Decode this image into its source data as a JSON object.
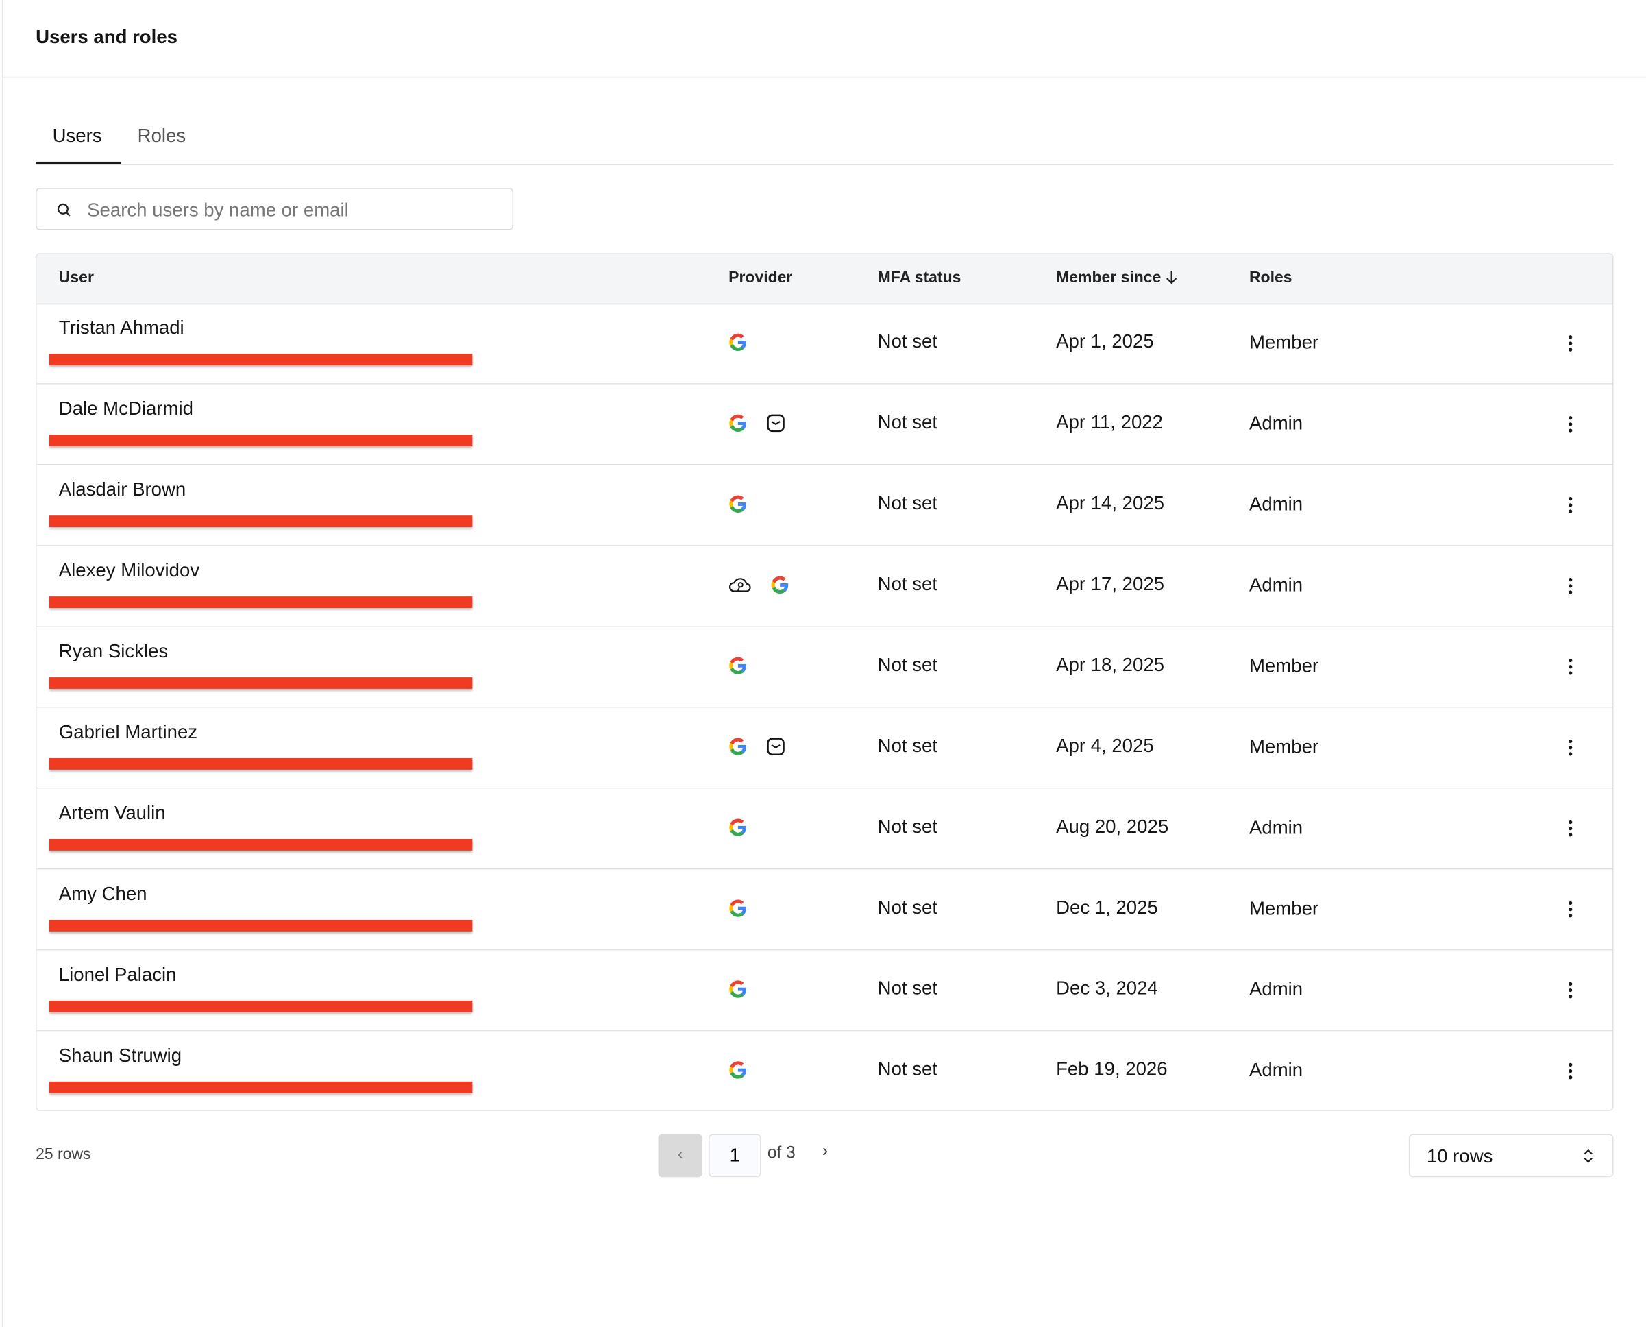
{
  "header": {
    "title": "Users and roles"
  },
  "tabs": [
    {
      "label": "Users",
      "active": true
    },
    {
      "label": "Roles",
      "active": false
    }
  ],
  "search": {
    "placeholder": "Search users by name or email",
    "value": ""
  },
  "table": {
    "columns": [
      "User",
      "Provider",
      "MFA status",
      "Member since",
      "Roles"
    ],
    "sort": {
      "column": "Member since",
      "direction": "descending",
      "icon": "arrow-down-icon"
    },
    "rows": [
      {
        "name": "Tristan Ahmadi",
        "providers": [
          "google"
        ],
        "mfa": "Not set",
        "member_since": "Apr 1, 2025",
        "role": "Member"
      },
      {
        "name": "Dale McDiarmid",
        "providers": [
          "google",
          "email"
        ],
        "mfa": "Not set",
        "member_since": "Apr 11, 2022",
        "role": "Admin"
      },
      {
        "name": "Alasdair Brown",
        "providers": [
          "google"
        ],
        "mfa": "Not set",
        "member_since": "Apr 14, 2025",
        "role": "Admin"
      },
      {
        "name": "Alexey Milovidov",
        "providers": [
          "cloud-key",
          "google"
        ],
        "mfa": "Not set",
        "member_since": "Apr 17, 2025",
        "role": "Admin"
      },
      {
        "name": "Ryan Sickles",
        "providers": [
          "google"
        ],
        "mfa": "Not set",
        "member_since": "Apr 18, 2025",
        "role": "Member"
      },
      {
        "name": "Gabriel Martinez",
        "providers": [
          "google",
          "email"
        ],
        "mfa": "Not set",
        "member_since": "Apr 4, 2025",
        "role": "Member"
      },
      {
        "name": "Artem Vaulin",
        "providers": [
          "google"
        ],
        "mfa": "Not set",
        "member_since": "Aug 20, 2025",
        "role": "Admin"
      },
      {
        "name": "Amy Chen",
        "providers": [
          "google"
        ],
        "mfa": "Not set",
        "member_since": "Dec 1, 2025",
        "role": "Member"
      },
      {
        "name": "Lionel Palacin",
        "providers": [
          "google"
        ],
        "mfa": "Not set",
        "member_since": "Dec 3, 2024",
        "role": "Admin"
      },
      {
        "name": "Shaun Struwig",
        "providers": [
          "google"
        ],
        "mfa": "Not set",
        "member_since": "Feb 19, 2026",
        "role": "Admin"
      }
    ]
  },
  "footer": {
    "row_count": "25 rows",
    "page": "1",
    "of_pages": "of 3",
    "rows_per_page": "10 rows"
  },
  "colors": {
    "redaction": "#f03a22",
    "header_bg": "#f4f5f7",
    "disabled_button": "#dadada"
  }
}
